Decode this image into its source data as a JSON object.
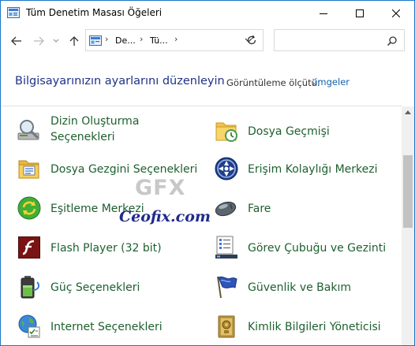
{
  "window": {
    "title": "Tüm Denetim Masası Öğeleri"
  },
  "titlebar": {
    "minimize_icon": "minimize-icon",
    "maximize_icon": "maximize-icon",
    "close_icon": "close-icon"
  },
  "toolbar": {
    "breadcrumbs": [
      "De...",
      "Tü..."
    ],
    "search_placeholder": ""
  },
  "header": {
    "heading": "Bilgisayarınızın ayarlarını düzenleyin",
    "view_label": "Görüntüleme ölçütü:",
    "view_value": "Küçük simgeler"
  },
  "items": [
    {
      "label": "Dizin Oluşturma Seçenekleri",
      "line1": "Dizin Oluşturma",
      "line2": "Seçenekleri",
      "icon": "indexing-icon"
    },
    {
      "label": "Dosya Geçmişi",
      "icon": "file-history-icon"
    },
    {
      "label": "Dosya Gezgini Seçenekleri",
      "icon": "folder-options-icon"
    },
    {
      "label": "Erişim Kolaylığı Merkezi",
      "icon": "ease-of-access-icon"
    },
    {
      "label": "Eşitleme Merkezi",
      "icon": "sync-center-icon"
    },
    {
      "label": "Fare",
      "icon": "mouse-icon"
    },
    {
      "label": "Flash Player (32 bit)",
      "icon": "flash-player-icon"
    },
    {
      "label": "Görev Çubuğu ve Gezinti",
      "icon": "taskbar-icon"
    },
    {
      "label": "Güç Seçenekleri",
      "icon": "power-options-icon"
    },
    {
      "label": "Güvenlik ve Bakım",
      "icon": "security-flag-icon"
    },
    {
      "label": "Internet Seçenekleri",
      "icon": "internet-options-icon"
    },
    {
      "label": "Kimlik Bilgileri Yöneticisi",
      "icon": "credential-manager-icon"
    }
  ],
  "watermark": {
    "logo_text": "GFX",
    "site": "Ceofix.com"
  },
  "colors": {
    "link_green": "#1d5f2e",
    "heading_blue": "#1e3287",
    "border_blue": "#1b78c8"
  }
}
